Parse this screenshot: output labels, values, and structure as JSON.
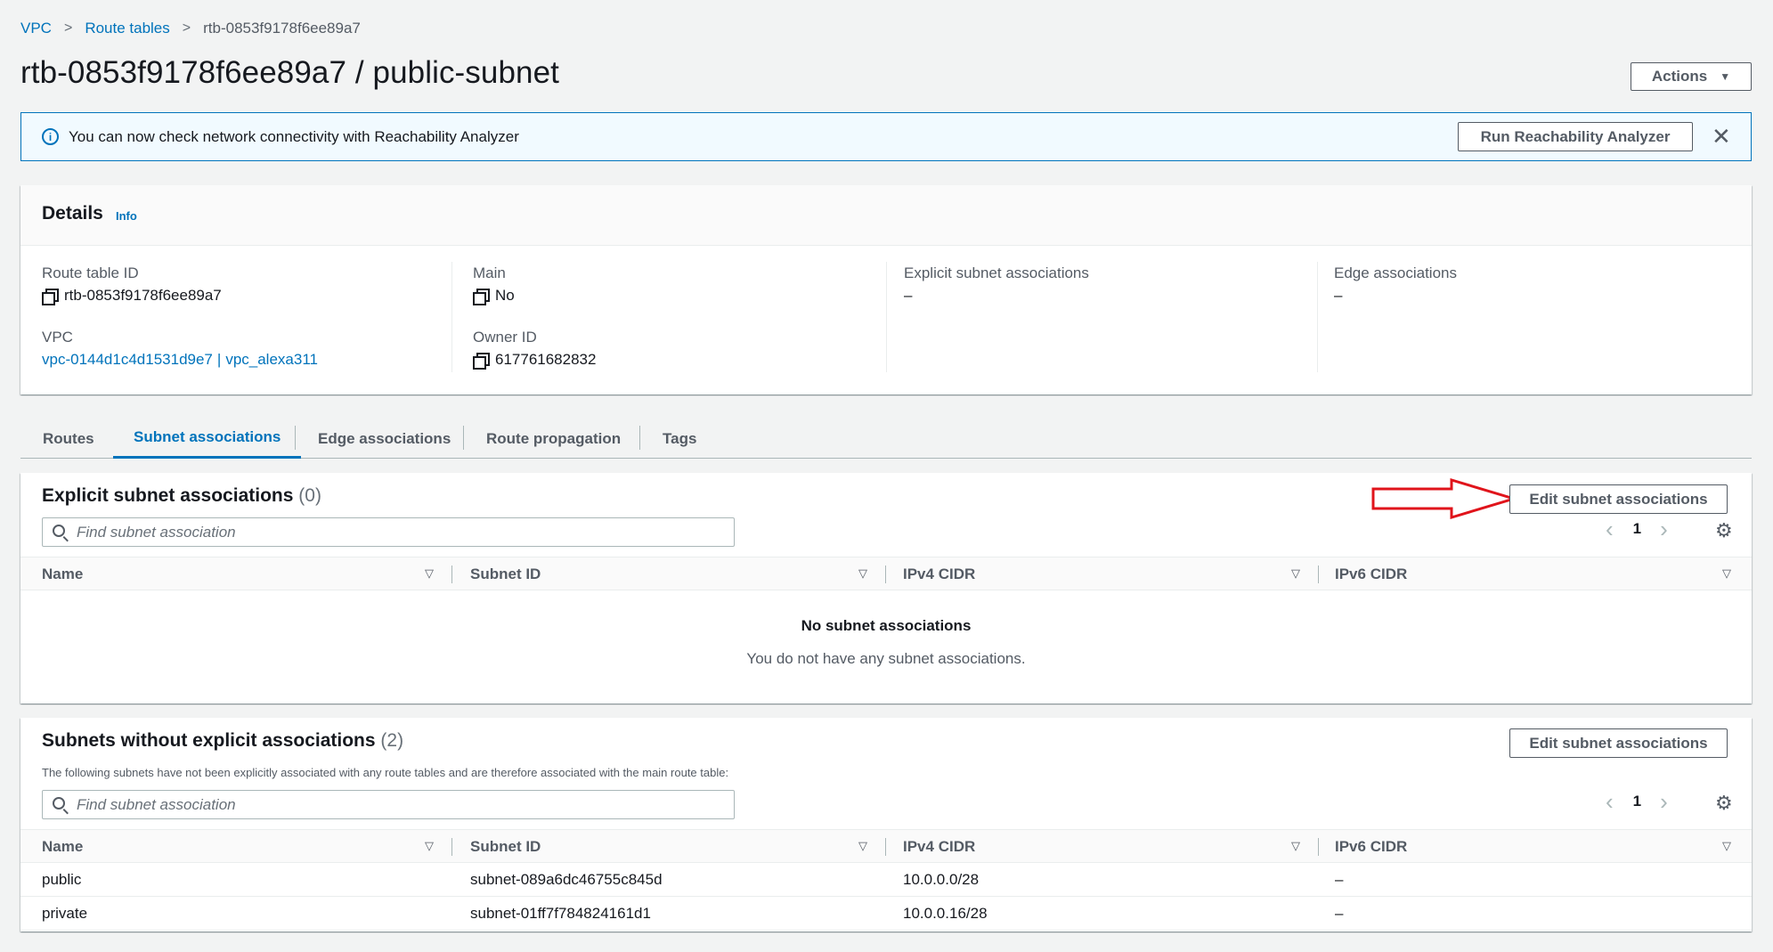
{
  "breadcrumb": {
    "items": [
      "VPC",
      "Route tables"
    ],
    "current": "rtb-0853f9178f6ee89a7"
  },
  "page_title": "rtb-0853f9178f6ee89a7 / public-subnet",
  "actions_label": "Actions",
  "flash": {
    "message": "You can now check network connectivity with Reachability Analyzer",
    "button_label": "Run Reachability Analyzer",
    "close_glyph": "✕"
  },
  "details": {
    "title": "Details",
    "info": "Info",
    "route_table_id_label": "Route table ID",
    "route_table_id": "rtb-0853f9178f6ee89a7",
    "vpc_label": "VPC",
    "vpc_id": "vpc-0144d1c4d1531d9e7",
    "vpc_sep": "|",
    "vpc_name": "vpc_alexa311",
    "main_label": "Main",
    "main_value": "No",
    "owner_label": "Owner ID",
    "owner_value": "617761682832",
    "explicit_label": "Explicit subnet associations",
    "explicit_value": "–",
    "edge_label": "Edge associations",
    "edge_value": "–"
  },
  "tabs": [
    "Routes",
    "Subnet associations",
    "Edge associations",
    "Route propagation",
    "Tags"
  ],
  "explicit_panel": {
    "title": "Explicit subnet associations",
    "count": "(0)",
    "edit_label": "Edit subnet associations",
    "search_placeholder": "Find subnet association",
    "page": "1",
    "columns": [
      "Name",
      "Subnet ID",
      "IPv4 CIDR",
      "IPv6 CIDR"
    ],
    "empty_title": "No subnet associations",
    "empty_desc": "You do not have any subnet associations."
  },
  "without_panel": {
    "title": "Subnets without explicit associations",
    "count": "(2)",
    "description": "The following subnets have not been explicitly associated with any route tables and are therefore associated with the main route table:",
    "edit_label": "Edit subnet associations",
    "search_placeholder": "Find subnet association",
    "page": "1",
    "columns": [
      "Name",
      "Subnet ID",
      "IPv4 CIDR",
      "IPv6 CIDR"
    ],
    "rows": [
      {
        "name": "public",
        "subnet_id": "subnet-089a6dc46755c845d",
        "ipv4": "10.0.0.0/28",
        "ipv6": "–"
      },
      {
        "name": "private",
        "subnet_id": "subnet-01ff7f784824161d1",
        "ipv4": "10.0.0.16/28",
        "ipv6": "–"
      }
    ]
  },
  "colors": {
    "link": "#0073bb",
    "annotation_arrow": "#e0141b"
  },
  "icons": {
    "chevron_left": "‹",
    "chevron_right": "›",
    "sort": "▽",
    "caret_down": "▼",
    "gear": "⚙"
  }
}
